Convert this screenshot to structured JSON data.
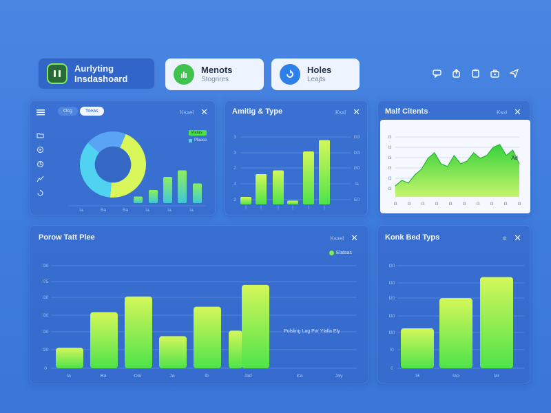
{
  "app": {
    "title_line1": "Aurlyting",
    "title_line2": "Insdashoard"
  },
  "header_pills": [
    {
      "title": "Menots",
      "subtitle": "Stogrires"
    },
    {
      "title": "Holes",
      "subtitle": "Leajts"
    }
  ],
  "top_icons": [
    "chat-icon",
    "share-icon",
    "clipboard-icon",
    "briefcase-icon",
    "send-icon"
  ],
  "panel1": {
    "tabs": [
      "Ocg",
      "Toeas"
    ],
    "control_label": "Ksxel",
    "legend": [
      "Viatas",
      "Plaase"
    ],
    "sidebar_icons": [
      "menu-icon",
      "folder-icon",
      "settings-icon",
      "target-icon",
      "chart-icon",
      "refresh-icon"
    ],
    "x_ticks": [
      "Ia",
      "Ba",
      "Ba",
      "Ia",
      "Ia",
      "Ia"
    ]
  },
  "panel2": {
    "title": "Amitig & Type",
    "control_label": "Ksxl",
    "left_ticks": [
      "3",
      "3",
      "2",
      "4",
      "2"
    ],
    "right_ticks": [
      "I33",
      "I33",
      "I30",
      "Ia",
      "E0"
    ]
  },
  "panel3": {
    "title": "Malf Citents",
    "control_label": "Ksxl",
    "annotation": "Ad",
    "y_ticks": [
      "I3",
      "I3",
      "I3",
      "I3",
      "I3",
      "I3"
    ],
    "x_ticks": [
      "I3",
      "I3",
      "I3",
      "I3",
      "I3",
      "I3",
      "I3",
      "I3",
      "I3",
      "I3"
    ]
  },
  "panel4": {
    "title": "Porow Tatt Plee",
    "control_label": "Ksxel",
    "legend": "Elalaas",
    "annotation": "Polsling Lag Por Ylalla Ely",
    "y_ticks": [
      "I30",
      "I75",
      "I20",
      "I30",
      "I30",
      "I20",
      "0"
    ],
    "x_ticks": [
      "Ia",
      "Ba",
      "Dai",
      "Ja",
      "Ib",
      "Jad",
      "Ica",
      "Jay"
    ]
  },
  "panel5": {
    "title": "Konk Bed Typs",
    "y_ticks": [
      "I30",
      "I30",
      "I20",
      "I30",
      "I30",
      "I0",
      "0"
    ],
    "x_ticks": [
      "I3",
      "Iao",
      "Iar"
    ]
  },
  "colors": {
    "accent_green": "#4ce24a",
    "accent_lime": "#d9f65a",
    "donut_cyan": "#5fc9f5"
  },
  "chart_data": [
    {
      "type": "pie",
      "values": [
        45,
        35,
        20
      ],
      "colors": [
        "#d9f65a",
        "#4fd3f0",
        "#5aa4f5"
      ],
      "inner_radius_ratio": 0.55
    },
    {
      "type": "bar",
      "categories": [
        "Ia",
        "Ba",
        "Ba",
        "Ia",
        "Ia"
      ],
      "values": [
        1,
        2,
        4,
        5,
        3
      ]
    },
    {
      "type": "bar",
      "values": [
        2,
        8,
        9,
        1,
        14,
        17
      ],
      "ylim": [
        0,
        20
      ]
    },
    {
      "type": "area",
      "x": [
        0,
        1,
        2,
        3,
        4,
        5,
        6,
        7,
        8,
        9,
        10,
        11,
        12,
        13,
        14,
        15,
        16,
        17,
        18,
        19
      ],
      "values": [
        2,
        3,
        2.5,
        4,
        5,
        7,
        8,
        6,
        5.5,
        7.5,
        6,
        6.5,
        8,
        7,
        7.5,
        9,
        9.5,
        7.5,
        8.5,
        6
      ],
      "ylim": [
        0,
        12
      ]
    },
    {
      "type": "bar",
      "categories": [
        "Ia",
        "Ba",
        "Dai",
        "Ja",
        "Ib",
        "Jad"
      ],
      "values": [
        30,
        82,
        105,
        47,
        90,
        55,
        122
      ],
      "ylim": [
        0,
        150
      ]
    },
    {
      "type": "bar",
      "categories": [
        "I3",
        "Iao",
        "Iar"
      ],
      "values": [
        70,
        123,
        160
      ],
      "ylim": [
        0,
        180
      ]
    }
  ]
}
